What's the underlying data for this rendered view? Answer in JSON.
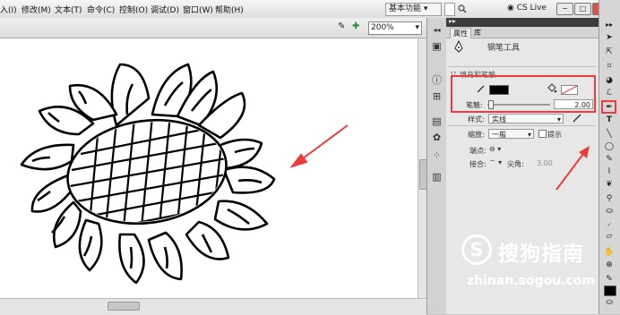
{
  "menu": {
    "items": [
      "入(I)",
      "修改(M)",
      "文本(T)",
      "命令(C)",
      "控制(O)",
      "调试(D)",
      "窗口(W)",
      "帮助(H)"
    ],
    "workspace_label": "基本功能",
    "cs_live": "CS Live",
    "window_buttons": [
      "−",
      "□",
      "×"
    ]
  },
  "stage": {
    "zoom_value": "200%"
  },
  "panel": {
    "tabs": [
      "属性",
      "库"
    ],
    "tool_name": "钢笔工具",
    "section_title": "填充和笔触",
    "stroke_label": "笔触:",
    "stroke_value": "2.00",
    "style_label": "样式:",
    "style_value": "实线",
    "scale_label": "缩放:",
    "scale_value": "一般",
    "hint_label": "提示",
    "end_label": "端点:",
    "join_label": "接合:",
    "miter_label": "尖角:",
    "miter_value": "3.00"
  },
  "watermark": {
    "logo": "S",
    "text": "搜狗指南",
    "url": "zhinan.sogou.com"
  },
  "colors": {
    "highlight_red": "#ee3b3b",
    "stroke_color": "#000000"
  },
  "icons": [
    "arrow-icon",
    "subselect-icon",
    "free-transform-icon",
    "lasso-icon",
    "pen-icon",
    "text-icon",
    "line-icon",
    "oval-icon",
    "pencil-icon",
    "brush-icon",
    "bucket-icon",
    "eyedropper-icon",
    "eraser-icon",
    "hand-icon",
    "zoom-icon"
  ]
}
